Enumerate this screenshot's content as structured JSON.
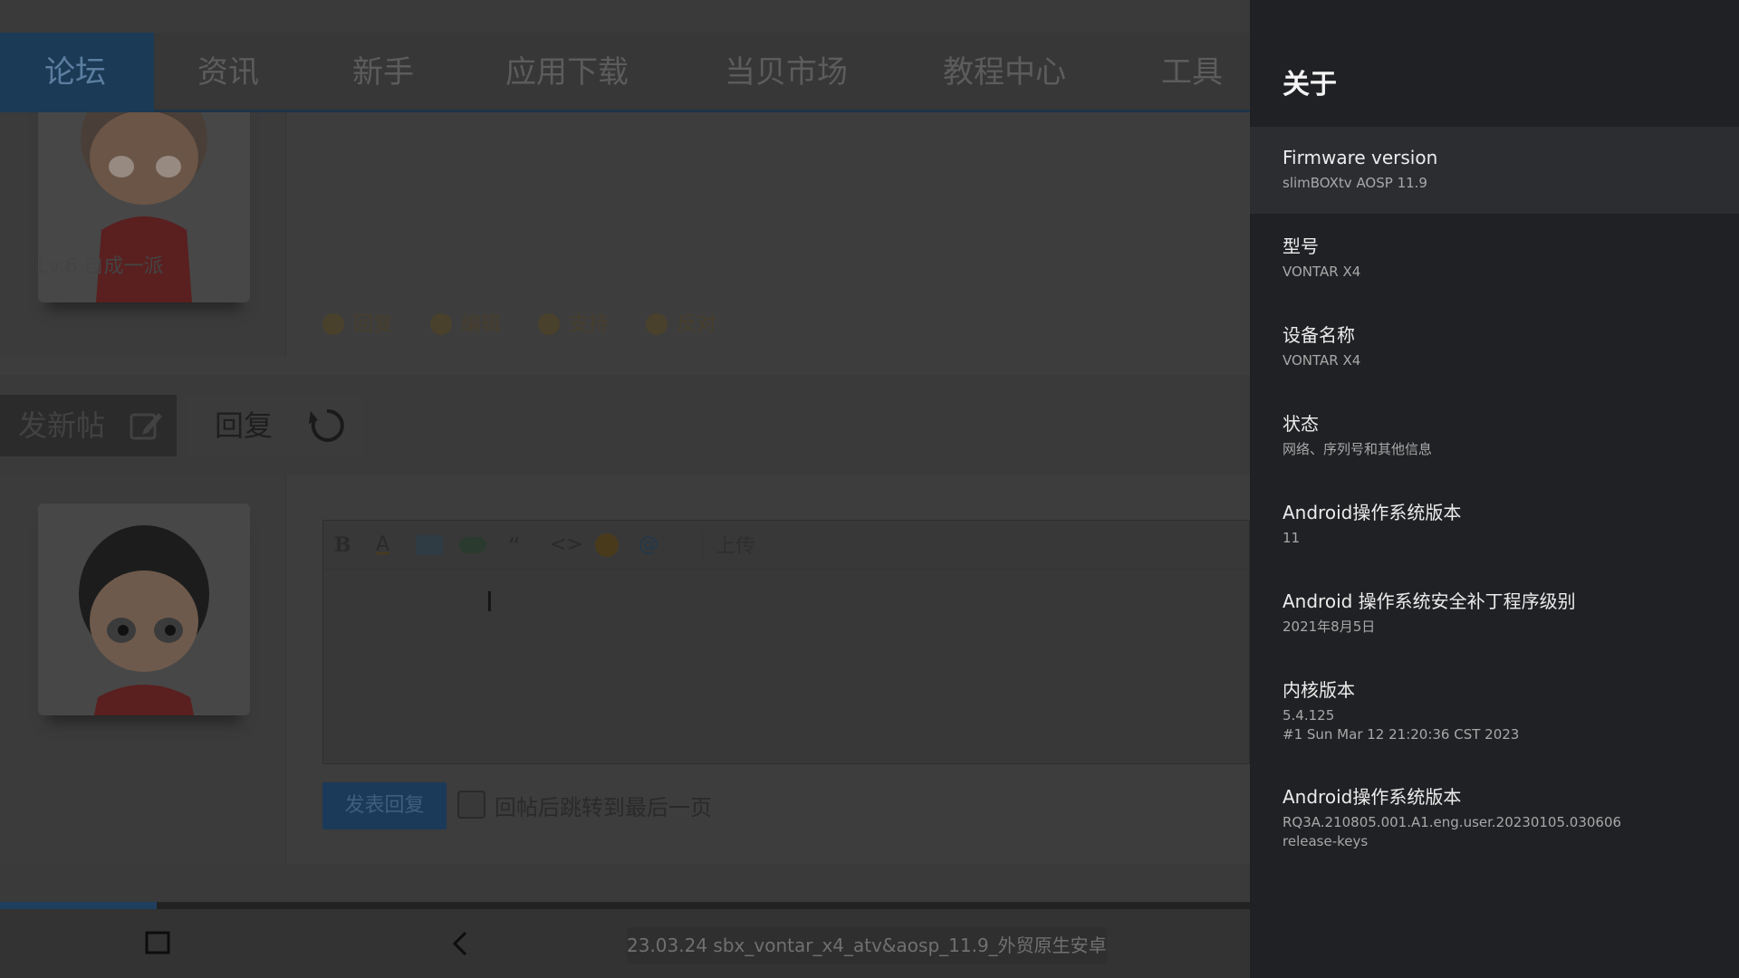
{
  "nav": {
    "items": [
      "论坛",
      "资讯",
      "新手",
      "应用下载",
      "当贝市场",
      "教程中心",
      "工具"
    ],
    "active_index": 0
  },
  "post": {
    "user_level": "Lv.6 自成一派",
    "actions": [
      "回复",
      "编辑",
      "支持",
      "反对"
    ]
  },
  "buttons": {
    "new_post": "发新帖",
    "reply": "回复"
  },
  "editor": {
    "toolbar": {
      "bold": "B",
      "font_color": "A",
      "quote": "“",
      "code": "<>",
      "at": "@",
      "upload": "上传"
    },
    "submit": "发表回复",
    "checkbox_label": "回帖后跳转到最后一页",
    "checkbox_checked": false
  },
  "progress": {
    "fraction": 0.125
  },
  "bottom_bar": {
    "url_text": "23.03.24 sbx_vontar_x4_atv&aosp_11.9_外贸原生安卓盒"
  },
  "panel": {
    "title": "关于",
    "items": [
      {
        "title": "Firmware version",
        "sub": "slimBOXtv AOSP 11.9"
      },
      {
        "title": "型号",
        "sub": "VONTAR X4"
      },
      {
        "title": "设备名称",
        "sub": "VONTAR X4"
      },
      {
        "title": "状态",
        "sub": "网络、序列号和其他信息"
      },
      {
        "title": "Android操作系统版本",
        "sub": "11"
      },
      {
        "title": "Android 操作系统安全补丁程序级别",
        "sub": "2021年8月5日"
      },
      {
        "title": "内核版本",
        "sub": "5.4.125\n#1 Sun Mar 12 21:20:36 CST 2023"
      },
      {
        "title": "Android操作系统版本",
        "sub": "RQ3A.210805.001.A1.eng.user.20230105.030606\nrelease-keys"
      }
    ],
    "focused_index": 0
  },
  "colors": {
    "panel_bg": "#202124",
    "panel_focus": "#2c2d31",
    "nav_active": "#1a3a55",
    "accent": "#1b3a59"
  }
}
